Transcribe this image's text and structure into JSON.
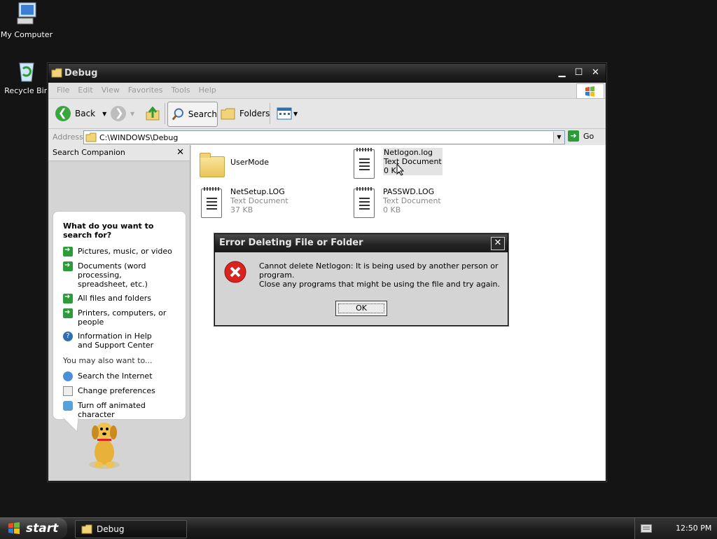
{
  "desktop": {
    "icons": [
      {
        "label": "My Computer",
        "icon": "my-computer-icon"
      },
      {
        "label": "Recycle Bin",
        "icon": "recycle-bin-icon"
      }
    ]
  },
  "window": {
    "title": "Debug",
    "menu": [
      "File",
      "Edit",
      "View",
      "Favorites",
      "Tools",
      "Help"
    ],
    "toolbar": {
      "back_label": "Back",
      "search_label": "Search",
      "folders_label": "Folders"
    },
    "address": {
      "label": "Address",
      "value": "C:\\WINDOWS\\Debug",
      "go_label": "Go"
    }
  },
  "companion": {
    "title": "Search Companion",
    "heading": "What do you want to search for?",
    "options": [
      {
        "label": "Pictures, music, or video",
        "icon": "arrow-right-icon"
      },
      {
        "label": "Documents (word processing, spreadsheet, etc.)",
        "icon": "arrow-right-icon"
      },
      {
        "label": "All files and folders",
        "icon": "arrow-right-icon"
      },
      {
        "label": "Printers, computers, or people",
        "icon": "arrow-right-icon"
      },
      {
        "label": "Information in Help and Support Center",
        "icon": "help-icon"
      }
    ],
    "also_label": "You may also want to...",
    "also": [
      {
        "label": "Search the Internet",
        "icon": "globe-search-icon"
      },
      {
        "label": "Change preferences",
        "icon": "preferences-icon"
      },
      {
        "label": "Turn off animated character",
        "icon": "character-icon"
      }
    ]
  },
  "files": [
    {
      "name": "UserMode",
      "type": "",
      "size": "",
      "kind": "folder"
    },
    {
      "name": "Netlogon.log",
      "type": "Text Document",
      "size": "0 KB",
      "kind": "text"
    },
    {
      "name": "NetSetup.LOG",
      "type": "Text Document",
      "size": "37 KB",
      "kind": "text"
    },
    {
      "name": "PASSWD.LOG",
      "type": "Text Document",
      "size": "0 KB",
      "kind": "text"
    }
  ],
  "dialog": {
    "title": "Error Deleting File or Folder",
    "message": "Cannot delete Netlogon: It is being used by another person or program.",
    "hint": "Close any programs that might be using the file and try again.",
    "ok_label": "OK"
  },
  "taskbar": {
    "start_label": "start",
    "task_label": "Debug",
    "clock": "12:50 PM"
  }
}
